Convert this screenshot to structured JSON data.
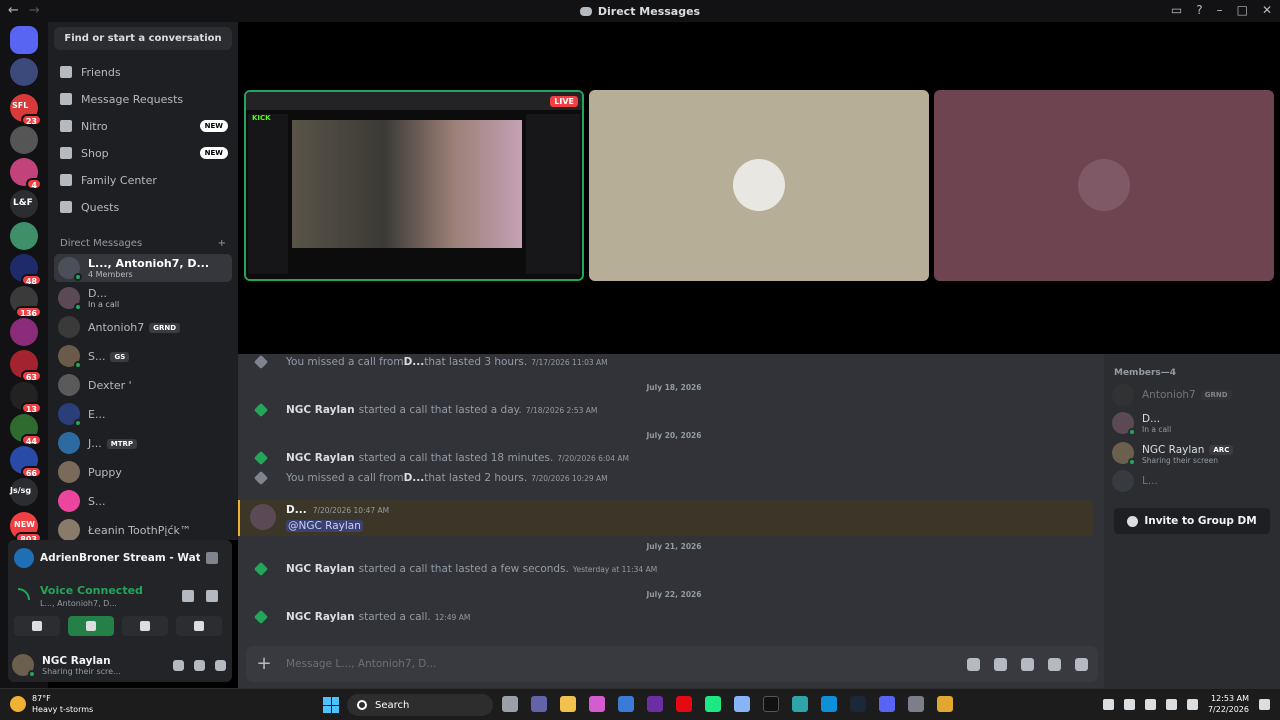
{
  "window": {
    "title": "Direct Messages",
    "back": "←",
    "forward": "→"
  },
  "rail": {
    "badges": [
      "23",
      "4",
      "48",
      "136",
      "63",
      "13",
      "44",
      "66",
      "803"
    ],
    "labels": {
      "lf": "L&F",
      "jssg": "Js/sg",
      "new": "NEW",
      "sfl": "SFL"
    }
  },
  "sidebar": {
    "find": "Find or start a conversation",
    "nav": [
      {
        "label": "Friends",
        "badge": ""
      },
      {
        "label": "Message Requests",
        "badge": ""
      },
      {
        "label": "Nitro",
        "badge": "NEW"
      },
      {
        "label": "Shop",
        "badge": "NEW"
      },
      {
        "label": "Family Center",
        "badge": ""
      },
      {
        "label": "Quests",
        "badge": ""
      }
    ],
    "dm_header": "Direct Messages",
    "dm_add": "+",
    "dms": [
      {
        "name": "L..., Antonioh7, D...",
        "sub": "4 Members",
        "tag": ""
      },
      {
        "name": "D...",
        "sub": "In a call",
        "tag": ""
      },
      {
        "name": "Antonioh7",
        "sub": "",
        "tag": "GRND"
      },
      {
        "name": "S...",
        "sub": "",
        "tag": "GS"
      },
      {
        "name": "Dexter '",
        "sub": "",
        "tag": ""
      },
      {
        "name": "E...",
        "sub": "",
        "tag": ""
      },
      {
        "name": "J...",
        "sub": "",
        "tag": "MTRP"
      },
      {
        "name": "Puppy",
        "sub": "",
        "tag": ""
      },
      {
        "name": "S...",
        "sub": "",
        "tag": ""
      },
      {
        "name": "Łeanin ToothPįćk™",
        "sub": "",
        "tag": ""
      }
    ]
  },
  "voice": {
    "stream_title": "AdrienBroner Stream - Watch Li...",
    "status": "Voice Connected",
    "channel": "L..., Antonioh7, D..."
  },
  "user": {
    "name": "NGC Raylan",
    "status": "Sharing their scre..."
  },
  "call": {
    "live_label": "LIVE",
    "kick_label": "KICK"
  },
  "chat": {
    "items": [
      {
        "kind": "msg",
        "icon": "grey",
        "prefix": "You missed a call from ",
        "name": "D...",
        "text": " that lasted 3 hours.",
        "ts": "7/17/2026 11:03 AM"
      },
      {
        "kind": "date",
        "text": "July 18, 2026"
      },
      {
        "kind": "msg",
        "icon": "green",
        "prefix": "",
        "name": "NGC Raylan",
        "text": "started a call that lasted a day.",
        "ts": "7/18/2026 2:53 AM"
      },
      {
        "kind": "date",
        "text": "July 20, 2026"
      },
      {
        "kind": "msg",
        "icon": "green",
        "prefix": "",
        "name": "NGC Raylan",
        "text": "started a call that lasted 18 minutes.",
        "ts": "7/20/2026 6:04 AM"
      },
      {
        "kind": "msg",
        "icon": "grey",
        "prefix": "You missed a call from ",
        "name": "D...",
        "text": " that lasted 2 hours.",
        "ts": "7/20/2026 10:29 AM"
      },
      {
        "kind": "date",
        "text": "July 21, 2026"
      },
      {
        "kind": "msg",
        "icon": "green",
        "prefix": "",
        "name": "NGC Raylan",
        "text": "started a call that lasted a few seconds.",
        "ts": "Yesterday at 11:34 AM"
      },
      {
        "kind": "date",
        "text": "July 22, 2026"
      },
      {
        "kind": "msg",
        "icon": "green",
        "prefix": "",
        "name": "NGC Raylan",
        "text": "started a call.",
        "ts": "12:49 AM"
      }
    ],
    "mention": {
      "author": "D...",
      "ts": "7/20/2026 10:47 AM",
      "text": "@NGC Raylan"
    },
    "composer_placeholder": "Message L..., Antonioh7, D..."
  },
  "members": {
    "header": "Members—4",
    "list": [
      {
        "name": "Antonioh7",
        "sub": "",
        "tag": "GRND"
      },
      {
        "name": "D...",
        "sub": "In a call",
        "tag": ""
      },
      {
        "name": "NGC Raylan",
        "sub": "Sharing their screen",
        "tag": "ARC"
      },
      {
        "name": "L...",
        "sub": "",
        "tag": ""
      }
    ],
    "invite": "Invite to Group DM"
  },
  "taskbar": {
    "temp": "87°F",
    "weather": "Heavy t-storms",
    "search": "Search",
    "time": "12:53 AM",
    "date": "7/22/2026"
  }
}
